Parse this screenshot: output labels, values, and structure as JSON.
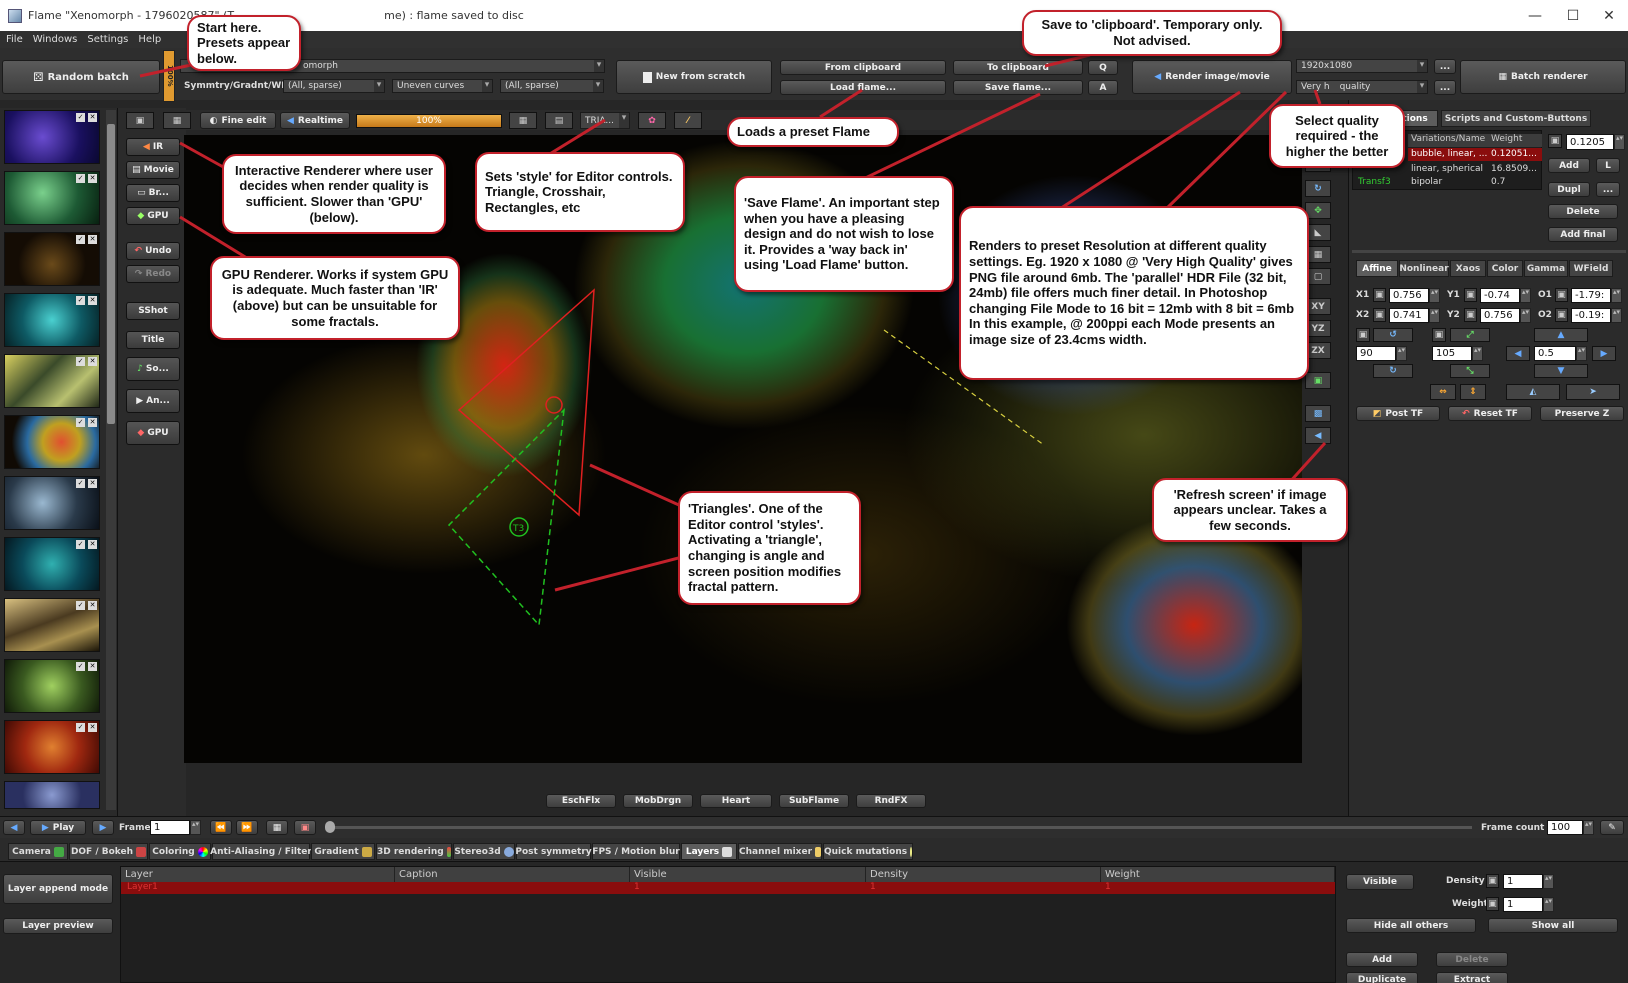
{
  "window": {
    "title": "Flame \"Xenomorph - 1796020587\" (T",
    "title_tail": "me) : flame saved to disc",
    "controls": [
      "—",
      "☐",
      "✕"
    ]
  },
  "menu": [
    "File",
    "Windows",
    "Settings",
    "Help"
  ],
  "toolbar": {
    "random_batch": "Random batch",
    "gen_name": "omorph",
    "symmetry_label": "Symmtry/Gradnt/WField",
    "symmetry_value": "(All, sparse)",
    "gradient_value": "Uneven curves",
    "wfield_value": "(All, sparse)",
    "new_from_scratch": "New from scratch",
    "from_clipboard": "From clipboard",
    "load_flame": "Load flame...",
    "to_clipboard": "To clipboard",
    "save_flame": "Save flame...",
    "small_q": "Q",
    "small_a": "A",
    "render_image": "Render image/movie",
    "resolution": "1920x1080",
    "quality": "Very h",
    "quality_tail": "quality",
    "ellipsis": "...",
    "batch_renderer": "Batch renderer",
    "batch_side": "100%"
  },
  "editor_bar": {
    "fine_edit": "Fine edit",
    "realtime": "Realtime",
    "progress_label": "100%",
    "progress": 1.0,
    "style": "TRIA..."
  },
  "left_buttons": [
    "IR",
    "Movie",
    "Br...",
    "GPU",
    "Undo",
    "Redo",
    "SShot",
    "Title",
    "So...",
    "An...",
    "GPU"
  ],
  "right_tools": [
    "XY",
    "YZ",
    "ZX"
  ],
  "bottom_fx": [
    "EschFlx",
    "MobDrgn",
    "Heart",
    "SubFlame",
    "RndFX"
  ],
  "timeline": {
    "play": "Play",
    "frame_label": "Frame",
    "frame_value": "1",
    "frame_count_label": "Frame count",
    "frame_count_value": "100"
  },
  "bottom_tabs": [
    "Camera",
    "DOF / Bokeh",
    "Coloring",
    "Anti-Aliasing / Filter",
    "Gradient",
    "3D rendering",
    "Stereo3d",
    "Post symmetry",
    "FPS / Motion blur",
    "Layers",
    "Channel mixer",
    "Quick mutations"
  ],
  "layers": {
    "append_mode": "Layer append mode",
    "preview": "Layer preview",
    "columns": [
      "Layer",
      "Caption",
      "Visible",
      "Density",
      "Weight"
    ],
    "row": [
      "Layer1",
      "",
      "1",
      "1",
      "1"
    ],
    "visible_btn": "Visible",
    "density_label": "Density",
    "density_value": "1",
    "weight_label": "Weight",
    "weight_value": "1",
    "hide_all_others": "Hide all others",
    "show_all": "Show all",
    "add": "Add",
    "delete": "Delete",
    "duplicate": "Duplicate",
    "extract": "Extract"
  },
  "right_panel": {
    "tab_variations": "ations",
    "tab_scripts": "Scripts and Custom-Buttons",
    "var_col_name": "Variations/Name",
    "var_col_weight": "Weight",
    "vars": [
      {
        "name": "bubble, linear, ...",
        "weight": "0.12051..."
      },
      {
        "name": "linear, spherical",
        "weight": "16.8509..."
      },
      {
        "name": "bipolar",
        "weight": "0.7"
      }
    ],
    "transf_label": "Transf3",
    "weight_field": "0.1205",
    "add": "Add",
    "l": "L",
    "dupl": "Dupl",
    "more": "...",
    "delete": "Delete",
    "add_final": "Add final",
    "affine_tabs": [
      "Affine",
      "Nonlinear",
      "Xaos",
      "Color",
      "Gamma",
      "WField"
    ],
    "x1": "0.756",
    "y1": "-0.74",
    "o1": "-1.79:",
    "x2": "0.741",
    "y2": "0.756",
    "o2": "-0.19:",
    "rot_value": "90",
    "scale_value": "105",
    "move_value": "0.5",
    "post_tf": "Post TF",
    "reset_tf": "Reset TF",
    "preserve_z": "Preserve Z"
  },
  "callouts": {
    "start": "Start here. Presets appear below.",
    "clipboard": "Save to 'clipboard'.  Temporary only.  Not advised.",
    "load_preset": "Loads a preset Flame",
    "quality": "Select quality required - the higher the better",
    "ir": "Interactive Renderer where user decides when render quality is sufficient. Slower than 'GPU' (below).",
    "style": "Sets 'style' for Editor controls.  Triangle, Crosshair, Rectangles, etc",
    "save_flame": "'Save Flame'.  An important step when you have a pleasing design and do not wish to lose it.  Provides a 'way back in' using 'Load Flame' button.",
    "renders": "Renders to preset Resolution at different quality settings.  Eg.  1920 x 1080 @ 'Very High Quality' gives PNG file around 6mb. The 'parallel' HDR File (32 bit, 24mb) file offers much finer detail.  In Photoshop changing File Mode to 16 bit = 12mb with 8 bit = 6mb In this example, @ 200ppi each Mode presents an image size of 23.4cms width.",
    "gpu": "GPU Renderer.  Works if system GPU is adequate.  Much faster than 'IR' (above) but can be unsuitable for some fractals.",
    "triangles": "'Triangles'.  One of the Editor control 'styles'. Activating a 'triangle', changing is angle and screen position modifies fractal pattern.",
    "refresh": "'Refresh screen' if image appears unclear.  Takes a few seconds."
  },
  "colors": {
    "accent_red": "#c2212b",
    "selected_row": "#8a0d0d",
    "progress": "#e8a13a"
  },
  "transform_labels": [
    "T3"
  ]
}
